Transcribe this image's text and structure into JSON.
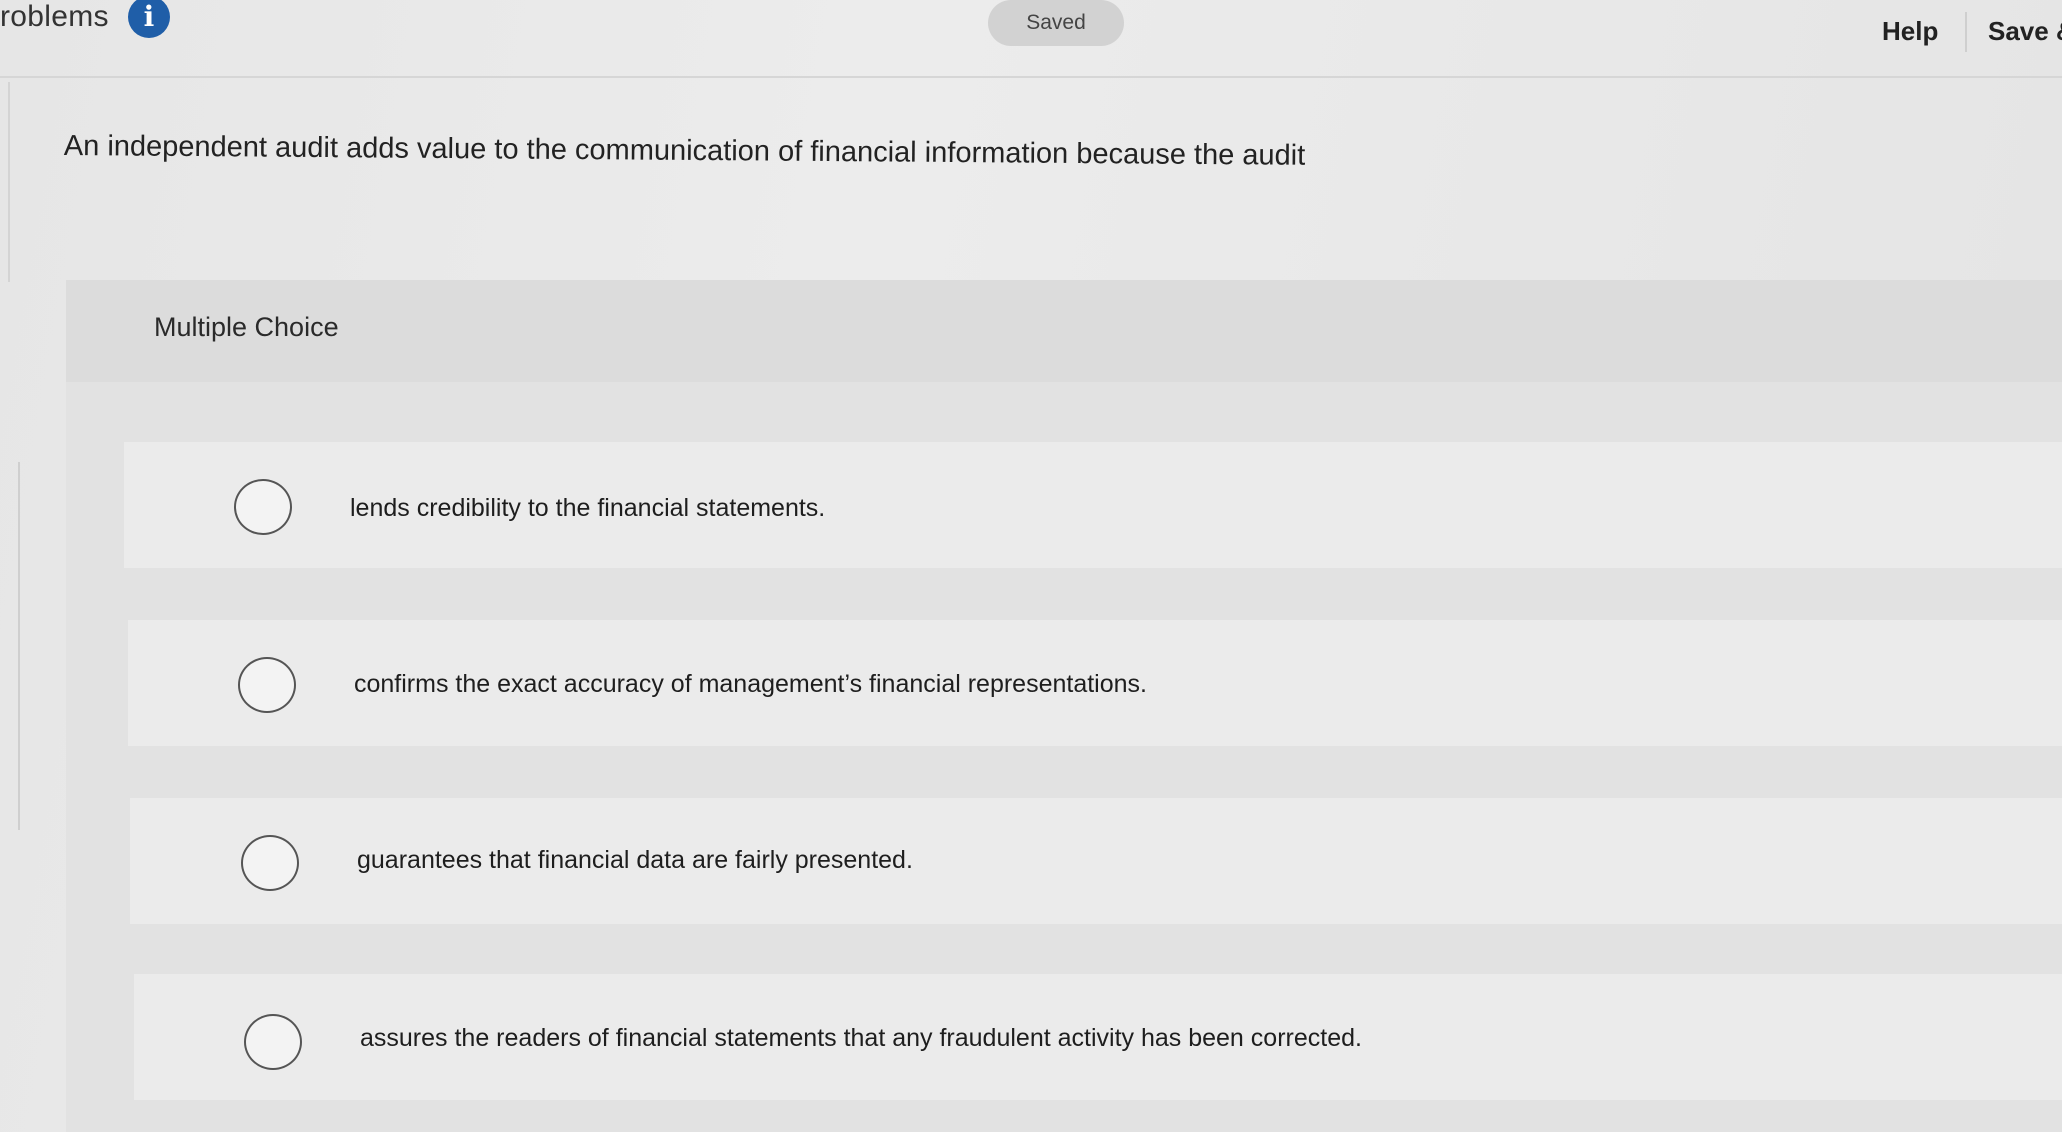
{
  "header": {
    "app_title": "roblems",
    "info_icon_glyph": "i",
    "saved_status": "Saved",
    "help_label": "Help",
    "save_exit_label": "Save &"
  },
  "question": {
    "text": "An independent audit adds value to the communication of financial information because the audit"
  },
  "multiple_choice": {
    "label": "Multiple Choice",
    "options": [
      {
        "text": "lends credibility to the financial statements.",
        "selected": false
      },
      {
        "text": "confirms the exact accuracy of management’s financial representations.",
        "selected": false
      },
      {
        "text": "guarantees that financial data are fairly presented.",
        "selected": false
      },
      {
        "text": "assures the readers of financial statements that any fraudulent activity has been corrected.",
        "selected": false
      }
    ]
  },
  "colors": {
    "info_icon": "#1f5ea8",
    "saved_pill": "#d2d2d2"
  }
}
